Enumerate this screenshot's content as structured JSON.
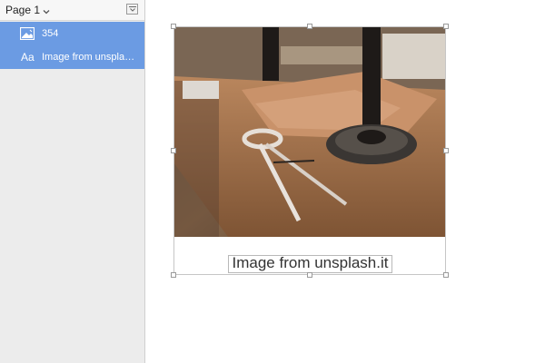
{
  "sidebar": {
    "page_title": "Page 1",
    "layers": [
      {
        "label": "354",
        "icon": "image-icon"
      },
      {
        "label": "Image from unsplash.it",
        "icon": "text-icon",
        "icon_text": "Aa"
      }
    ]
  },
  "canvas": {
    "caption": "Image from unsplash.it"
  },
  "colors": {
    "selection_blue": "#6b9be3",
    "sidebar_bg": "#ececec"
  }
}
